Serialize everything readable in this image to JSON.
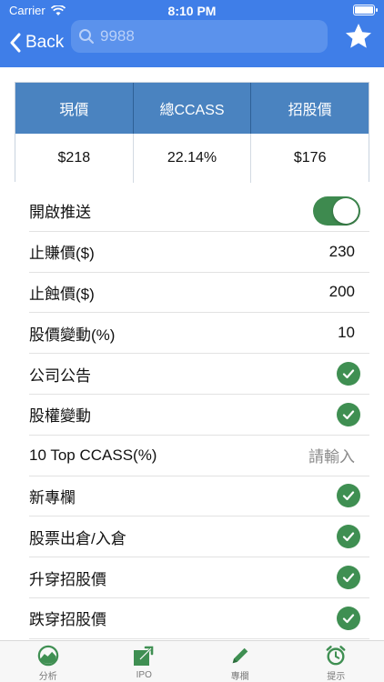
{
  "status_bar": {
    "carrier": "Carrier",
    "time": "8:10 PM"
  },
  "nav": {
    "back_label": "Back",
    "search_placeholder": "9988"
  },
  "summary": {
    "headers": [
      "現價",
      "總CCASS",
      "招股價"
    ],
    "values": [
      "$218",
      "22.14%",
      "$176"
    ]
  },
  "settings": [
    {
      "label": "開啟推送",
      "type": "toggle",
      "on": true
    },
    {
      "label": "止賺價($)",
      "type": "value",
      "value": "230"
    },
    {
      "label": "止蝕價($)",
      "type": "value",
      "value": "200"
    },
    {
      "label": "股價變動(%)",
      "type": "value",
      "value": "10"
    },
    {
      "label": "公司公告",
      "type": "check",
      "checked": true
    },
    {
      "label": "股權變動",
      "type": "check",
      "checked": true
    },
    {
      "label": "10 Top CCASS(%)",
      "type": "input",
      "placeholder": "請輸入"
    },
    {
      "label": "新專欄",
      "type": "check",
      "checked": true
    },
    {
      "label": "股票出倉/入倉",
      "type": "check",
      "checked": true
    },
    {
      "label": "升穿招股價",
      "type": "check",
      "checked": true
    },
    {
      "label": "跌穿招股價",
      "type": "check",
      "checked": true
    }
  ],
  "tabbar": {
    "tabs": [
      {
        "label": "分析",
        "icon": "chart-analysis-icon"
      },
      {
        "label": "IPO",
        "icon": "ipo-export-icon"
      },
      {
        "label": "專欄",
        "icon": "pencil-icon"
      },
      {
        "label": "提示",
        "icon": "alarm-clock-icon"
      }
    ]
  },
  "colors": {
    "header": "#3f7ee8",
    "table_header": "#4a83c0",
    "check_green": "#3f8f52"
  }
}
